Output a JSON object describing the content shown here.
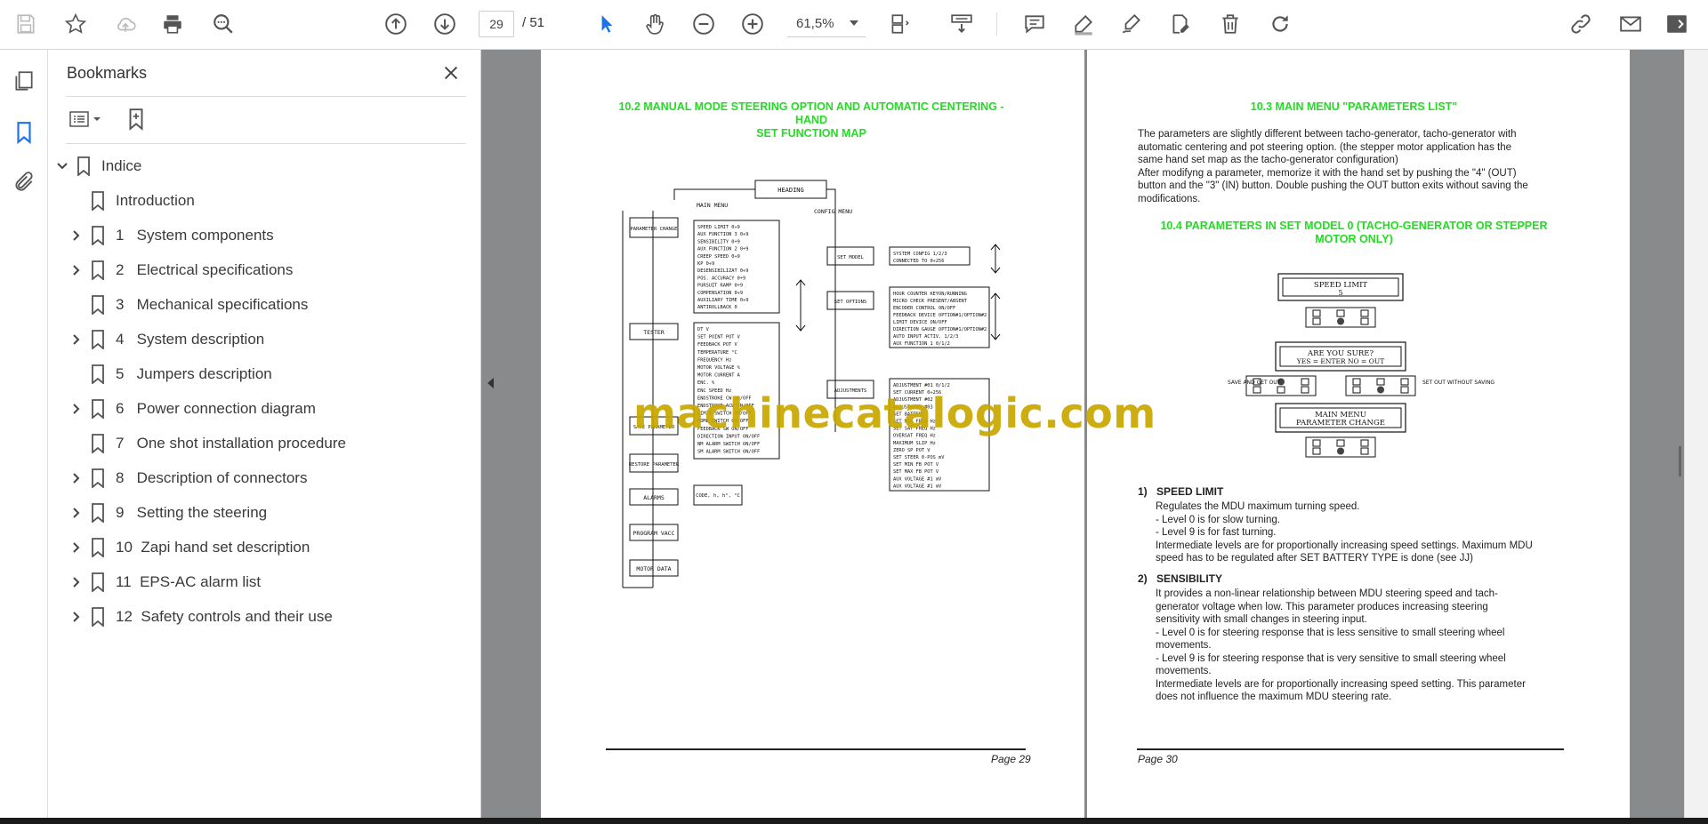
{
  "toolbar": {
    "current_page": "29",
    "page_total": "/ 51",
    "zoom": "61,5%"
  },
  "panel": {
    "title": "Bookmarks"
  },
  "bookmarks": [
    {
      "label": "Indice",
      "has_children": true,
      "expanded": true
    },
    {
      "label": "Introduction",
      "has_children": false
    },
    {
      "label": "1   System components",
      "has_children": true
    },
    {
      "label": "2   Electrical specifications",
      "has_children": true
    },
    {
      "label": "3   Mechanical specifications",
      "has_children": false
    },
    {
      "label": "4   System description",
      "has_children": true
    },
    {
      "label": "5   Jumpers description",
      "has_children": false
    },
    {
      "label": "6   Power connection diagram",
      "has_children": true
    },
    {
      "label": "7   One shot installation procedure",
      "has_children": false
    },
    {
      "label": "8   Description of connectors",
      "has_children": true
    },
    {
      "label": "9   Setting the steering",
      "has_children": true
    },
    {
      "label": "10  Zapi hand set description",
      "has_children": true
    },
    {
      "label": "11  EPS-AC alarm list",
      "has_children": true
    },
    {
      "label": "12  Safety controls and their use",
      "has_children": true
    }
  ],
  "page29": {
    "title_line1": "10.2 MANUAL MODE STEERING OPTION AND AUTOMATIC CENTERING - HAND",
    "title_line2": "SET FUNCTION MAP",
    "footer": "Page 29",
    "diagram": {
      "heading": "HEADING",
      "main_menu": "MAIN MENU",
      "config_menu": "CONFIG MENU",
      "parameter_change": "PARAMETER CHANGE",
      "tester": "TESTER",
      "save_parameter": "SAVE PARAMETER",
      "restore_parameter": "RESTORE PARAMETER",
      "alarms": "ALARMS",
      "program_vacc": "PROGRAM VACC",
      "motor_data": "MOTOR DATA",
      "set_model": "SET MODEL",
      "set_options": "SET OPTIONS",
      "adjustments": "ADJUSTMENTS",
      "code_box": "CODE, h, h°, °C",
      "param_list": [
        "SPEED LIMIT 0÷9",
        "AUX FUNCTION 3 0÷9",
        "SENSIBILITY 0÷9",
        "AUX FUNCTION 2 0÷9",
        "CREEP SPEED 0÷9",
        "KP 0÷9",
        "DESENSIBILIZAT 0÷9",
        "POS. ACCURACY 0÷9",
        "PURSUIT RAMP 0÷9",
        "COMPENSATION 0÷9",
        "AUXILIARY TIME 0÷9",
        "ANTIROLLBACK 0"
      ],
      "tester_list": [
        "DT V",
        "SET POINT POT V",
        "FEEDBACK POT V",
        "TEMPERATURE °C",
        "FREQUENCY Hz",
        "MOTOR VOLTAGE %",
        "MOTOR CURRENT A",
        "ENC. %",
        "ENC SPEED Hz",
        "ENDSTROKE CW ON/OFF",
        "ENDSTROKE ACW ON/OFF",
        "LIMIT SWITCH ON/OFF",
        "HOME SWITCH ON/OFF",
        "FEEDBACK SW ON/OFF",
        "DIRECTION INPUT ON/OFF",
        "NM ALARM SWITCH ON/OFF",
        "SM ALARM SWITCH ON/OFF"
      ],
      "model_list": [
        "SYSTEM CONFIG 1/2/3",
        "CONNECTED TO 0÷256"
      ],
      "options_list": [
        "HOUR COUNTER KEYON/RUNNING",
        "MICRO CHECK PRESENT/ABSENT",
        "ENCODER CONTROL ON/OFF",
        "FEEDBACK DEVICE OPTION#1/OPTION#2",
        "LIMIT DEVICE ON/OFF",
        "DIRECTION GAUGE OPTION#1/OPTION#2",
        "AUTO INPUT ACTIV. 1/2/3",
        "AUX FUNCTION 1 0/1/2"
      ],
      "adjust_list": [
        "ADJUSTMENT #01 0/1/2",
        "SET CURRENT 0÷256",
        "ADJUSTMENT #02",
        "ADJUSTMENT #03",
        "SET BATTERY",
        "SET MIN FREQ Hz",
        "SET SAT FREQ Hz",
        "OVERSAT FREQ Hz",
        "MAXIMUM SLIP Hz",
        "ZERO SP POT V",
        "SET STEER 0-POS mV",
        "SET MIN FB POT V",
        "SET MAX FB POT V",
        "AUX VOLTAGE #1 mV",
        "AUX VOLTAGE #1 mV"
      ]
    }
  },
  "page30": {
    "title1": "10.3 MAIN MENU \"PARAMETERS LIST\"",
    "intro_lines": [
      "The parameters are slightly different between tacho-generator, tacho-generator with",
      "automatic centering and pot steering option. (the stepper motor application has the",
      "same hand set map as the tacho-generator configuration)",
      "After modifyng a parameter, memorize it with the hand set by pushing the \"4\" (OUT)",
      "button and the \"3\" (IN) button. Double pushing the OUT button exits without saving the",
      "modifications."
    ],
    "title2_line1": "10.4 PARAMETERS IN SET MODEL 0 (TACHO-GENERATOR OR STEPPER",
    "title2_line2": "MOTOR ONLY)",
    "fig": {
      "speed_limit": "SPEED LIMIT",
      "speed_value": "5",
      "are_you_sure": "ARE YOU SURE?",
      "yes_no": "YES = ENTER NO = OUT",
      "save_and_get_out": "SAVE AND GET OUT",
      "set_out_without_saving": "SET OUT WITHOUT SAVING",
      "main_menu": "MAIN MENU",
      "parameter_change": "PARAMETER CHANGE"
    },
    "items": [
      {
        "num": "1)",
        "heading": "SPEED LIMIT",
        "lines": [
          "Regulates the MDU maximum turning speed.",
          "- Level 0 is for slow turning.",
          "- Level 9 is for fast turning.",
          "Intermediate levels are for proportionally increasing speed settings. Maximum MDU",
          "speed has to be regulated after SET BATTERY TYPE is done (see JJ)"
        ]
      },
      {
        "num": "2)",
        "heading": "SENSIBILITY",
        "lines": [
          "It provides a non-linear relationship between MDU steering speed and tach-",
          "generator voltage when low. This parameter produces increasing steering",
          "sensitivity with small changes in steering input.",
          "- Level 0 is for steering response that is less sensitive to small steering wheel",
          "movements.",
          "- Level 9 is for steering response that is very sensitive to small steering wheel",
          "movements.",
          "Intermediate levels are for proportionally increasing speed setting. This parameter",
          "does not influence the maximum MDU steering rate."
        ]
      }
    ],
    "footer": "Page 30"
  },
  "watermark": "machinecatalogic.com"
}
